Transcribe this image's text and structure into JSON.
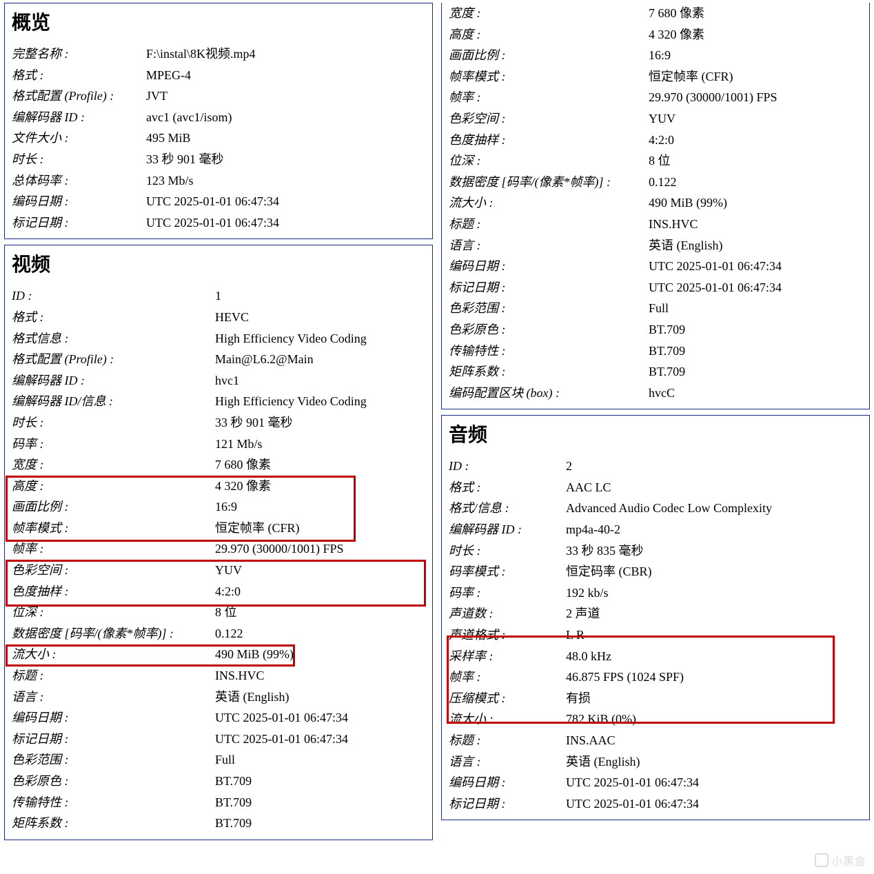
{
  "watermark": "小黑盒",
  "overview": {
    "title": "概览",
    "rows": [
      {
        "label": "完整名称 :",
        "value": "F:\\instal\\8K视频.mp4"
      },
      {
        "label": "格式 :",
        "value": "MPEG-4"
      },
      {
        "label": "格式配置 (Profile) :",
        "value": "JVT"
      },
      {
        "label": "编解码器 ID :",
        "value": "avc1 (avc1/isom)"
      },
      {
        "label": "文件大小 :",
        "value": "495 MiB"
      },
      {
        "label": "时长 :",
        "value": "33 秒 901 毫秒"
      },
      {
        "label": "总体码率 :",
        "value": "123 Mb/s"
      },
      {
        "label": "编码日期 :",
        "value": "UTC 2025-01-01 06:47:34"
      },
      {
        "label": "标记日期 :",
        "value": "UTC 2025-01-01 06:47:34"
      }
    ]
  },
  "video_left": {
    "title": "视频",
    "rows": [
      {
        "label": "ID :",
        "value": "1"
      },
      {
        "label": "格式 :",
        "value": "HEVC"
      },
      {
        "label": "格式信息 :",
        "value": "High Efficiency Video Coding"
      },
      {
        "label": "格式配置 (Profile) :",
        "value": "Main@L6.2@Main"
      },
      {
        "label": "编解码器 ID :",
        "value": "hvc1"
      },
      {
        "label": "编解码器 ID/信息 :",
        "value": "High Efficiency Video Coding"
      },
      {
        "label": "时长 :",
        "value": "33 秒 901 毫秒"
      },
      {
        "label": "码率 :",
        "value": "121 Mb/s"
      },
      {
        "label": "宽度 :",
        "value": "7 680 像素"
      },
      {
        "label": "高度 :",
        "value": "4 320 像素"
      },
      {
        "label": "画面比例 :",
        "value": "16:9"
      },
      {
        "label": "帧率模式 :",
        "value": "恒定帧率 (CFR)"
      },
      {
        "label": "帧率 :",
        "value": "29.970 (30000/1001) FPS"
      },
      {
        "label": "色彩空间 :",
        "value": "YUV"
      },
      {
        "label": "色度抽样 :",
        "value": "4:2:0"
      },
      {
        "label": "位深 :",
        "value": "8 位"
      },
      {
        "label": "数据密度 [码率/(像素*帧率)] :",
        "value": "0.122"
      },
      {
        "label": "流大小 :",
        "value": "490 MiB (99%)"
      },
      {
        "label": "标题 :",
        "value": "INS.HVC"
      },
      {
        "label": "语言 :",
        "value": "英语 (English)"
      },
      {
        "label": "编码日期 :",
        "value": "UTC 2025-01-01 06:47:34"
      },
      {
        "label": "标记日期 :",
        "value": "UTC 2025-01-01 06:47:34"
      },
      {
        "label": "色彩范围 :",
        "value": "Full"
      },
      {
        "label": "色彩原色 :",
        "value": "BT.709"
      },
      {
        "label": "传输特性 :",
        "value": "BT.709"
      },
      {
        "label": "矩阵系数 :",
        "value": "BT.709"
      }
    ]
  },
  "video_right": {
    "rows": [
      {
        "label": "宽度 :",
        "value": "7 680 像素"
      },
      {
        "label": "高度 :",
        "value": "4 320 像素"
      },
      {
        "label": "画面比例 :",
        "value": "16:9"
      },
      {
        "label": "帧率模式 :",
        "value": "恒定帧率 (CFR)"
      },
      {
        "label": "帧率 :",
        "value": "29.970 (30000/1001) FPS"
      },
      {
        "label": "色彩空间 :",
        "value": "YUV"
      },
      {
        "label": "色度抽样 :",
        "value": "4:2:0"
      },
      {
        "label": "位深 :",
        "value": "8 位"
      },
      {
        "label": "数据密度 [码率/(像素*帧率)] :",
        "value": "0.122"
      },
      {
        "label": "流大小 :",
        "value": "490 MiB (99%)"
      },
      {
        "label": "标题 :",
        "value": "INS.HVC"
      },
      {
        "label": "语言 :",
        "value": "英语 (English)"
      },
      {
        "label": "编码日期 :",
        "value": "UTC 2025-01-01 06:47:34"
      },
      {
        "label": "标记日期 :",
        "value": "UTC 2025-01-01 06:47:34"
      },
      {
        "label": "色彩范围 :",
        "value": "Full"
      },
      {
        "label": "色彩原色 :",
        "value": "BT.709"
      },
      {
        "label": "传输特性 :",
        "value": "BT.709"
      },
      {
        "label": "矩阵系数 :",
        "value": "BT.709"
      },
      {
        "label": "编码配置区块 (box) :",
        "value": "hvcC"
      }
    ]
  },
  "audio": {
    "title": "音频",
    "rows": [
      {
        "label": "ID :",
        "value": "2"
      },
      {
        "label": "格式 :",
        "value": "AAC LC"
      },
      {
        "label": "格式/信息 :",
        "value": "Advanced Audio Codec Low Complexity"
      },
      {
        "label": "编解码器 ID :",
        "value": "mp4a-40-2"
      },
      {
        "label": "时长 :",
        "value": "33 秒 835 毫秒"
      },
      {
        "label": "码率模式 :",
        "value": "恒定码率 (CBR)"
      },
      {
        "label": "码率 :",
        "value": "192 kb/s"
      },
      {
        "label": "声道数 :",
        "value": "2 声道"
      },
      {
        "label": "声道格式 :",
        "value": "L R"
      },
      {
        "label": "采样率 :",
        "value": "48.0 kHz"
      },
      {
        "label": "帧率 :",
        "value": "46.875 FPS (1024 SPF)"
      },
      {
        "label": "压缩模式 :",
        "value": "有损"
      },
      {
        "label": "流大小 :",
        "value": "782 KiB (0%)"
      },
      {
        "label": "标题 :",
        "value": "INS.AAC"
      },
      {
        "label": "语言 :",
        "value": "英语 (English)"
      },
      {
        "label": "编码日期 :",
        "value": "UTC 2025-01-01 06:47:34"
      },
      {
        "label": "标记日期 :",
        "value": "UTC 2025-01-01 06:47:34"
      }
    ]
  }
}
